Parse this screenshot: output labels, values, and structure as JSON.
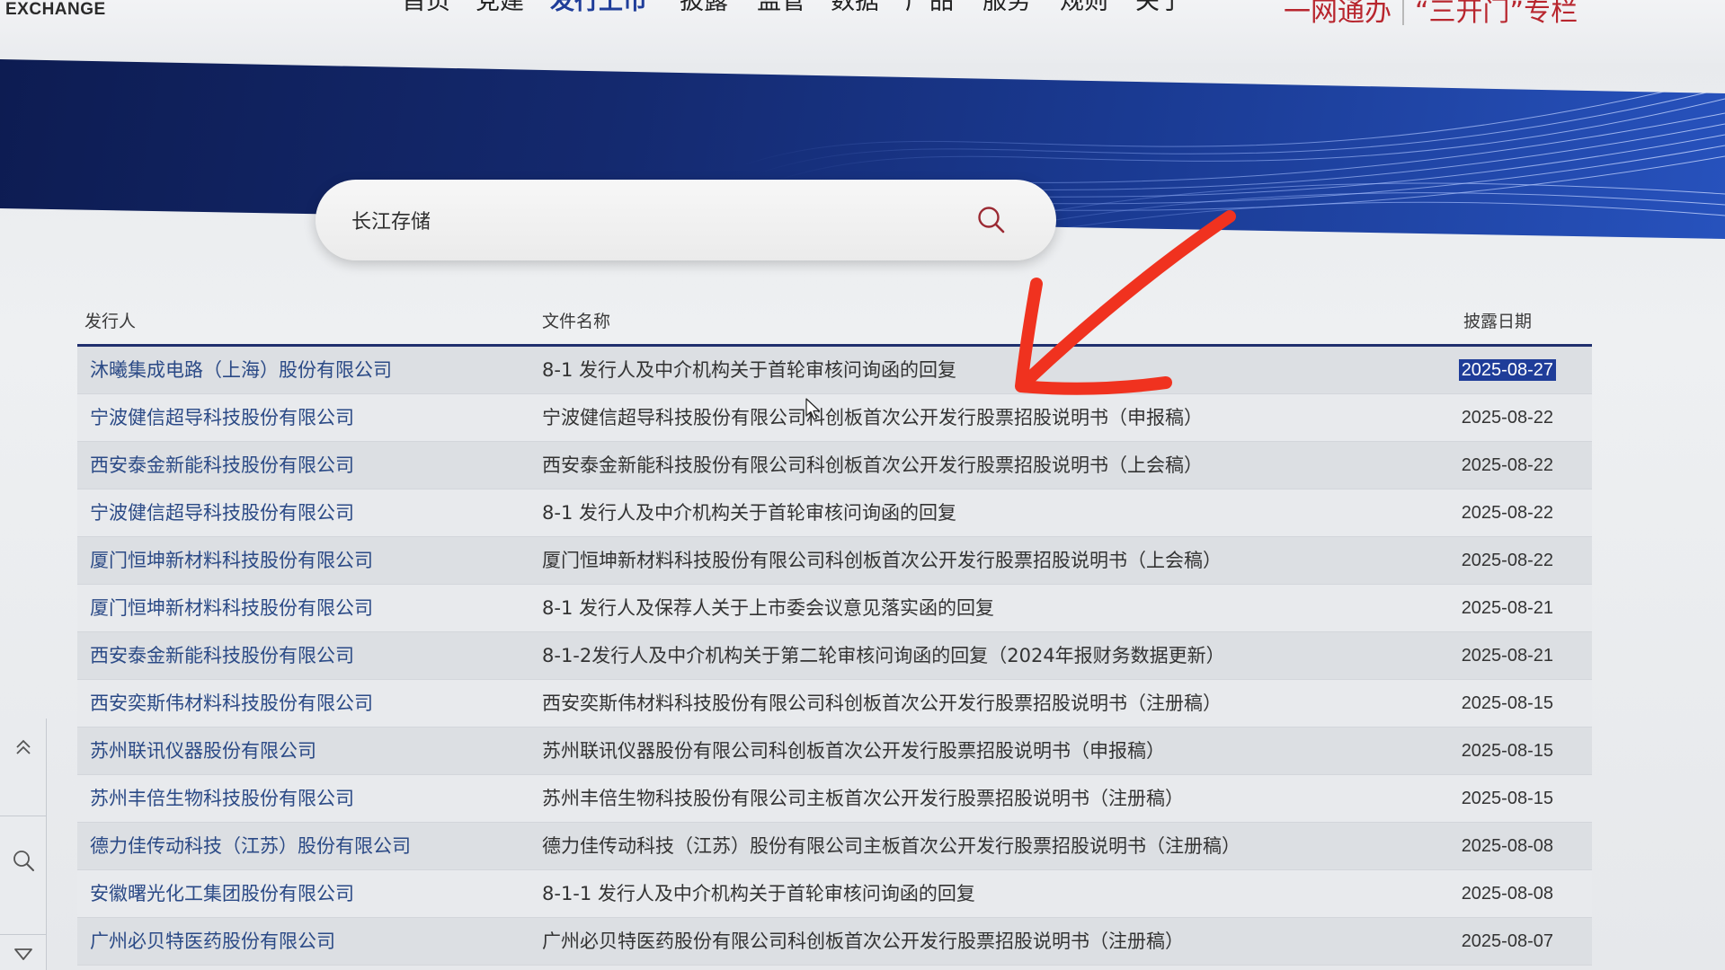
{
  "header": {
    "brand": "EXCHANGE",
    "nav": [
      {
        "label": "首页"
      },
      {
        "label": "党建"
      },
      {
        "label": "发行上市",
        "active": true
      },
      {
        "label": "披露"
      },
      {
        "label": "监管"
      },
      {
        "label": "数据"
      },
      {
        "label": "产品"
      },
      {
        "label": "服务"
      },
      {
        "label": "规则"
      },
      {
        "label": "关于"
      }
    ],
    "quick_links": [
      {
        "label": "一网通办"
      },
      {
        "label": "“三开门”专栏"
      }
    ]
  },
  "search": {
    "value": "长江存储",
    "icon": "search-icon"
  },
  "table": {
    "columns": {
      "issuer": "发行人",
      "document": "文件名称",
      "date": "披露日期"
    },
    "rows": [
      {
        "issuer": "沐曦集成电路（上海）股份有限公司",
        "document": "8-1 发行人及中介机构关于首轮审核问询函的回复",
        "date": "2025-08-27",
        "date_selected": true
      },
      {
        "issuer": "宁波健信超导科技股份有限公司",
        "document": "宁波健信超导科技股份有限公司科创板首次公开发行股票招股说明书（申报稿）",
        "date": "2025-08-22"
      },
      {
        "issuer": "西安泰金新能科技股份有限公司",
        "document": "西安泰金新能科技股份有限公司科创板首次公开发行股票招股说明书（上会稿）",
        "date": "2025-08-22"
      },
      {
        "issuer": "宁波健信超导科技股份有限公司",
        "document": "8-1 发行人及中介机构关于首轮审核问询函的回复",
        "date": "2025-08-22"
      },
      {
        "issuer": "厦门恒坤新材料科技股份有限公司",
        "document": "厦门恒坤新材料科技股份有限公司科创板首次公开发行股票招股说明书（上会稿）",
        "date": "2025-08-22"
      },
      {
        "issuer": "厦门恒坤新材料科技股份有限公司",
        "document": "8-1 发行人及保荐人关于上市委会议意见落实函的回复",
        "date": "2025-08-21"
      },
      {
        "issuer": "西安泰金新能科技股份有限公司",
        "document": "8-1-2发行人及中介机构关于第二轮审核问询函的回复（2024年报财务数据更新）",
        "date": "2025-08-21"
      },
      {
        "issuer": "西安奕斯伟材料科技股份有限公司",
        "document": "西安奕斯伟材料科技股份有限公司科创板首次公开发行股票招股说明书（注册稿）",
        "date": "2025-08-15"
      },
      {
        "issuer": "苏州联讯仪器股份有限公司",
        "document": "苏州联讯仪器股份有限公司科创板首次公开发行股票招股说明书（申报稿）",
        "date": "2025-08-15"
      },
      {
        "issuer": "苏州丰倍生物科技股份有限公司",
        "document": "苏州丰倍生物科技股份有限公司主板首次公开发行股票招股说明书（注册稿）",
        "date": "2025-08-15"
      },
      {
        "issuer": "德力佳传动科技（江苏）股份有限公司",
        "document": "德力佳传动科技（江苏）股份有限公司主板首次公开发行股票招股说明书（注册稿）",
        "date": "2025-08-08"
      },
      {
        "issuer": "安徽曙光化工集团股份有限公司",
        "document": "8-1-1 发行人及中介机构关于首轮审核问询函的回复",
        "date": "2025-08-08"
      },
      {
        "issuer": "广州必贝特医药股份有限公司",
        "document": "广州必贝特医药股份有限公司科创板首次公开发行股票招股说明书（注册稿）",
        "date": "2025-08-07"
      }
    ]
  },
  "side_toolbar": {
    "items": [
      {
        "icon": "double-chevron-up-icon"
      },
      {
        "icon": "search-icon"
      },
      {
        "icon": "caret-down-icon"
      }
    ]
  },
  "overlay": {
    "annotation_icon": "hand-drawn-arrow-icon",
    "cursor_icon": "mouse-cursor-icon"
  },
  "colors": {
    "accent": "#1f3d99",
    "link_red": "#b8262e",
    "annotation_red": "#f0321f",
    "issuer_blue": "#2b4a86",
    "banner_navy": "#14296e"
  }
}
